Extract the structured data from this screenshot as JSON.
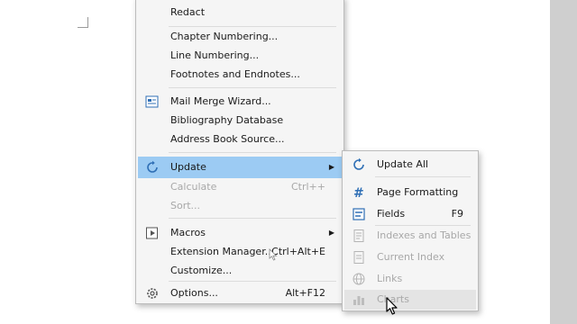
{
  "tools_menu": {
    "items": [
      {
        "label": "Redact",
        "mnemonic": "a"
      },
      {
        "label": "Chapter Numbering..."
      },
      {
        "label": "Line Numbering..."
      },
      {
        "label": "Footnotes and Endnotes..."
      },
      {
        "label": "Mail Merge Wizard..."
      },
      {
        "label": "Bibliography Database"
      },
      {
        "label": "Address Book Source..."
      },
      {
        "label": "Update"
      },
      {
        "label": "Calculate",
        "shortcut": "Ctrl++"
      },
      {
        "label": "Sort..."
      },
      {
        "label": "Macros"
      },
      {
        "label": "Extension Manager...",
        "shortcut": "Ctrl+Alt+E"
      },
      {
        "label": "Customize..."
      },
      {
        "label": "Options...",
        "shortcut": "Alt+F12"
      }
    ]
  },
  "update_submenu": {
    "items": [
      {
        "label": "Update All"
      },
      {
        "label": "Page Formatting"
      },
      {
        "label": "Fields",
        "shortcut": "F9"
      },
      {
        "label": "Indexes and Tables"
      },
      {
        "label": "Current Index"
      },
      {
        "label": "Links"
      },
      {
        "label": "Charts"
      }
    ]
  },
  "colors": {
    "highlight": "#9ccbf3",
    "menu_bg": "#f5f5f5",
    "disabled_text": "#a8a8a8",
    "icon_blue": "#2f6fb5"
  }
}
